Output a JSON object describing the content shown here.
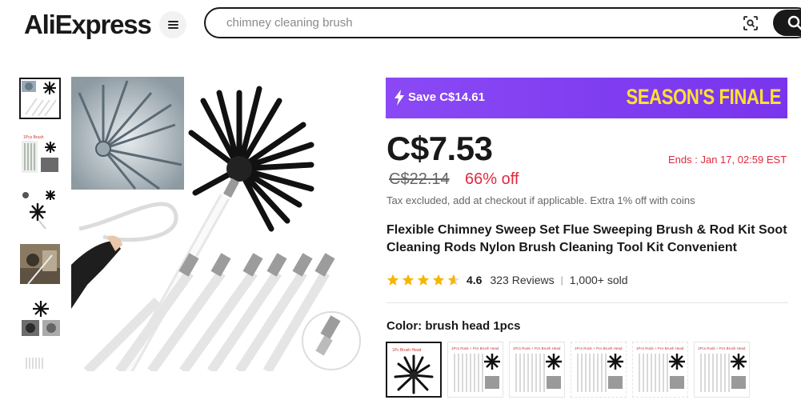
{
  "header": {
    "logo": "AliExpress",
    "search_value": "chimney cleaning brush"
  },
  "icons": {
    "menu": "menu-icon",
    "camera": "camera-search-icon",
    "search": "search-icon",
    "bolt": "lightning-icon",
    "star": "star-icon"
  },
  "colors": {
    "brand_black": "#191919",
    "promo_purple": "#8a49f5",
    "promo_yellow": "#ffe033",
    "sale_red": "#e0293e",
    "star_yellow": "#f7b500"
  },
  "promo": {
    "save_text": "Save C$14.61",
    "campaign": "SEASON'S FINALE"
  },
  "pricing": {
    "price": "C$7.53",
    "ends": "Ends :  Jan 17, 02:59 EST",
    "original_price": "C$22.14",
    "discount": "66% off",
    "tax_note": "Tax excluded, add at checkout if applicable. Extra 1% off with coins"
  },
  "product": {
    "title": "Flexible Chimney Sweep Set Flue Sweeping Brush & Rod Kit Soot Cleaning Rods Nylon Brush Cleaning Tool Kit Convenient",
    "rating": "4.6",
    "rating_value": 4.6,
    "reviews": "323 Reviews",
    "separator": "|",
    "sold": "1,000+ sold"
  },
  "variants": {
    "color_label": "Color: brush head 1pcs",
    "selected_index": 0
  }
}
